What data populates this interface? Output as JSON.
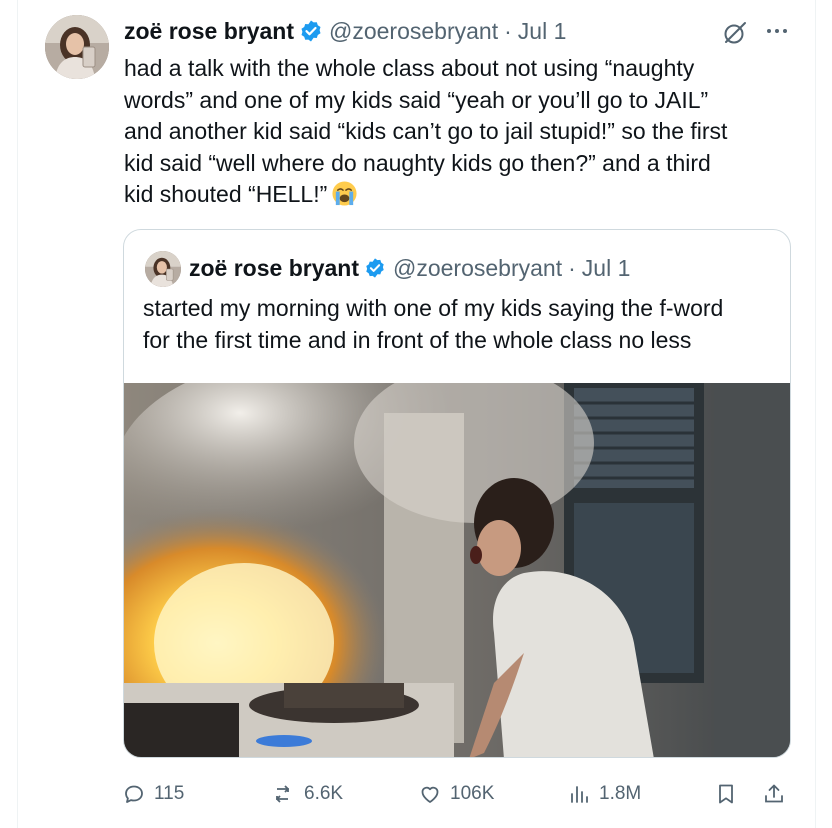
{
  "colors": {
    "accent": "#1d9bf0",
    "text": "#0f1419",
    "muted": "#536471",
    "border": "#cfd9de"
  },
  "tweet": {
    "author": {
      "display_name": "zoë rose bryant",
      "handle": "@zoerosebryant",
      "verified": true,
      "avatar_icon": "avatar-photo"
    },
    "separator": "·",
    "date": "Jul 1",
    "text": "had a talk with the whole class about not using “naughty\nwords” and one of my kids said “yeah or you’ll go to JAIL”\nand another kid said “kids can’t go to jail stupid!” so the first\nkid said “well where do naughty kids go then?” and a third\nkid shouted “HELL!”",
    "emoji": "loudly-crying-face"
  },
  "quoted_tweet": {
    "author": {
      "display_name": "zoë rose bryant",
      "handle": "@zoerosebryant",
      "verified": true
    },
    "separator": "·",
    "date": "Jul 1",
    "text": "started my morning with one of my kids saying the f-word\nfor the first time and in front of the whole class no less",
    "media": "photo-kitchen-fire-man-screaming"
  },
  "actions": {
    "replies": "115",
    "reposts": "6.6K",
    "likes": "106K",
    "views": "1.8M"
  }
}
